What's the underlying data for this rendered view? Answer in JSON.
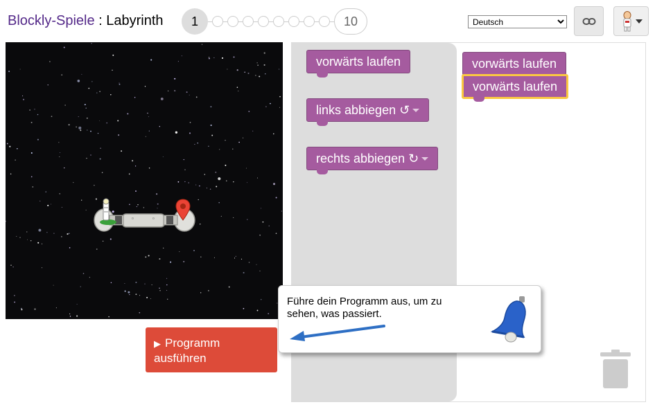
{
  "header": {
    "brand": "Blockly-Spiele",
    "separator": " : ",
    "game": "Labyrinth",
    "level_current": "1",
    "level_last": "10",
    "language": "Deutsch",
    "language_options": [
      "Deutsch"
    ]
  },
  "icons": {
    "link": "link-icon",
    "pegman": "pegman-icon"
  },
  "maze": {
    "goal_marker": "map-pin-icon",
    "player": "pegman-icon"
  },
  "run_button": {
    "icon": "play-icon",
    "label": "Programm ausführen"
  },
  "toolbox": {
    "blocks": [
      {
        "label": "vorwärts laufen"
      },
      {
        "label": "links abbiegen ↺"
      },
      {
        "label": "rechts abbiegen ↻"
      }
    ]
  },
  "workspace": {
    "blocks": [
      {
        "label": "vorwärts laufen"
      },
      {
        "label": "vorwärts laufen"
      }
    ]
  },
  "tooltip": {
    "text": "Führe dein Programm aus, um zu sehen, was passiert.",
    "icon": "bell-icon"
  },
  "colors": {
    "brand": "#542989",
    "block": "#a55b9f",
    "run_button": "#dd4b39",
    "selected": "#fac841"
  }
}
